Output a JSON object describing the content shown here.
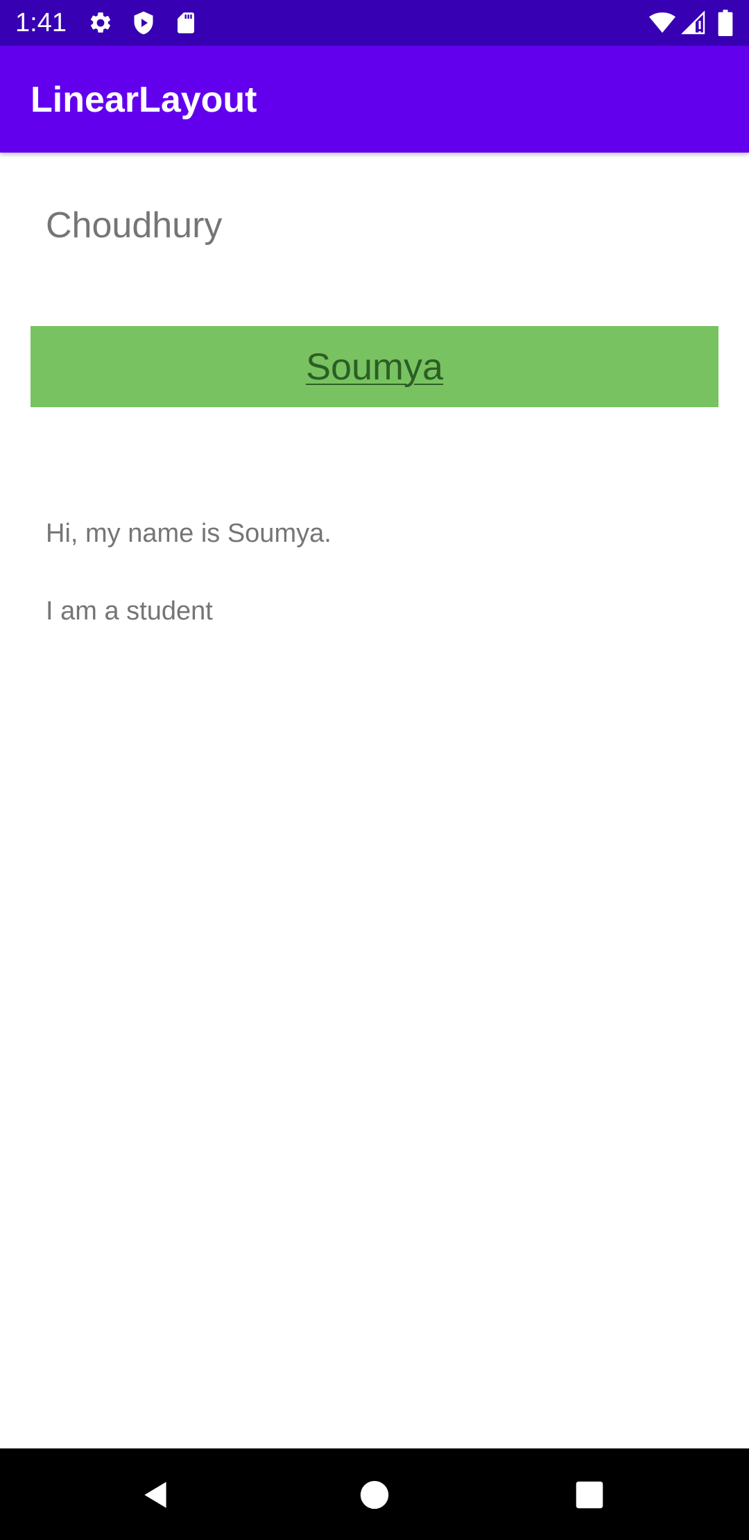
{
  "status_bar": {
    "time": "1:41",
    "left_icons": [
      "gear-icon",
      "shield-play-icon",
      "sd-card-icon"
    ],
    "right_icons": [
      "wifi-icon",
      "signal-icon",
      "battery-icon"
    ],
    "background_color": "#3700b3"
  },
  "app_bar": {
    "title": "LinearLayout",
    "background_color": "#6200ee"
  },
  "content": {
    "surname": "Choudhury",
    "name_box": {
      "label": "Soumya",
      "background_color": "#79c261",
      "text_color": "#2c5e24"
    },
    "line1": "Hi, my name is Soumya.",
    "line2": "I am a student"
  },
  "nav_bar": {
    "buttons": [
      "back-icon",
      "home-icon",
      "recents-icon"
    ],
    "background_color": "#000000"
  }
}
